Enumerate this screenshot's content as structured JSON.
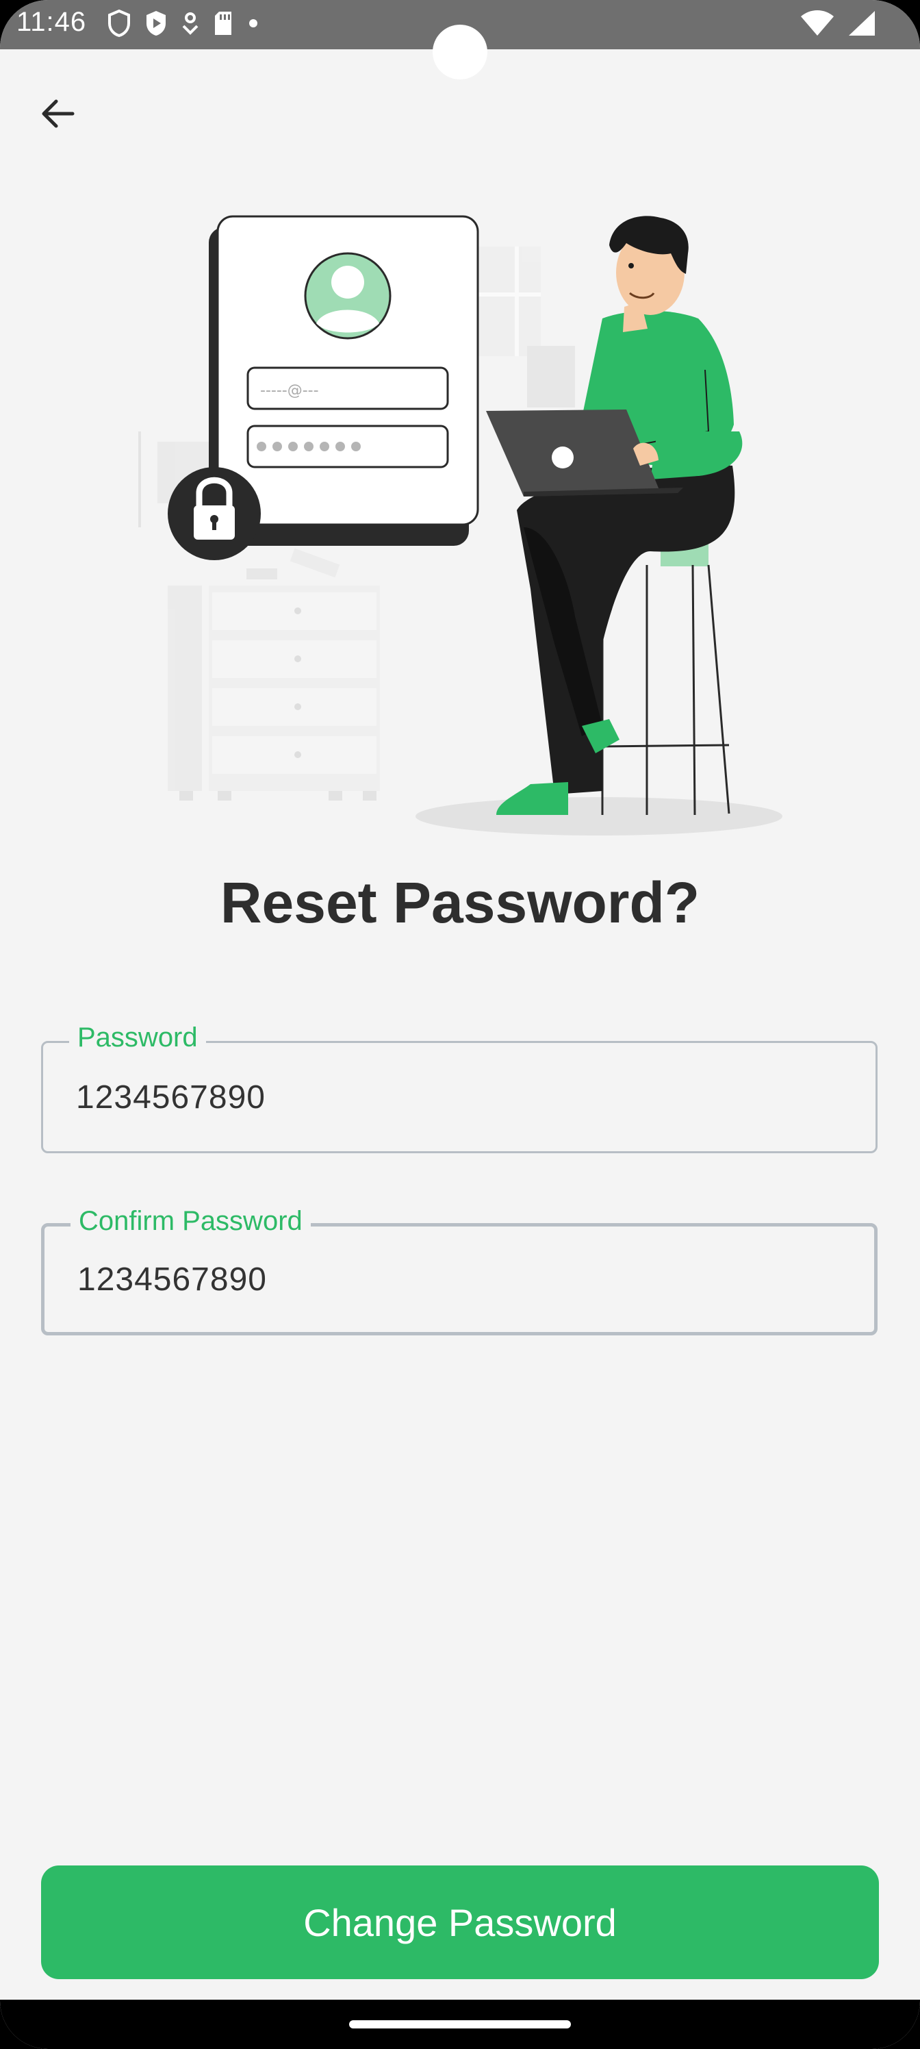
{
  "status_bar": {
    "time": "11:46"
  },
  "header": {
    "back_icon": "arrow-left-icon"
  },
  "title": "Reset Password?",
  "form": {
    "password": {
      "label": "Password",
      "value": "1234567890"
    },
    "confirm_password": {
      "label": "Confirm Password",
      "value": "1234567890"
    }
  },
  "cta_label": "Change Password",
  "colors": {
    "accent": "#2dba66",
    "background": "#f4f4f4",
    "status_bar": "#6f6f6f"
  },
  "illustration_form_placeholders": {
    "email_mask": "-----@---"
  }
}
